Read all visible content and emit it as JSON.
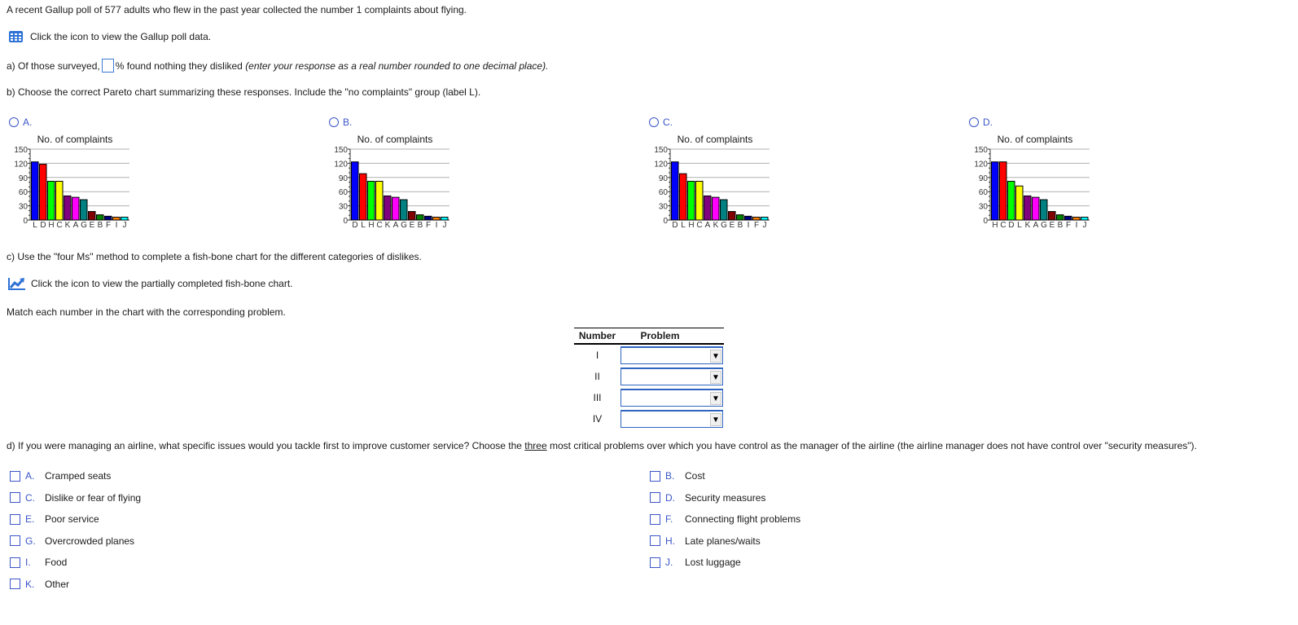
{
  "intro": "A recent Gallup poll of 577 adults who flew in the past year collected the number 1 complaints about flying.",
  "poll_link": {
    "icon": "table-grid-icon",
    "label": "Click the icon to view the Gallup poll data."
  },
  "part_a": {
    "prefix": "a) Of those surveyed,",
    "answer_value": "",
    "suffix": "% found nothing they disliked",
    "hint": "(enter your response as a real number rounded to one decimal place)."
  },
  "part_b": {
    "prompt": "b) Choose the correct Pareto chart summarizing these responses. Include the \"no complaints\" group (label L)."
  },
  "chart_data": [
    {
      "option": "A.",
      "type": "bar",
      "title": "No. of complaints",
      "categories": [
        "L",
        "D",
        "H",
        "C",
        "K",
        "A",
        "G",
        "E",
        "B",
        "F",
        "I",
        "J"
      ],
      "values": [
        123,
        118,
        82,
        82,
        51,
        48,
        43,
        18,
        11,
        8,
        6,
        6
      ],
      "colors": [
        "#0000ff",
        "#ff0000",
        "#00ff00",
        "#ffff00",
        "#800080",
        "#ff00ff",
        "#008080",
        "#800000",
        "#008000",
        "#000080",
        "#ff8000",
        "#00ffff"
      ],
      "yticks": [
        0,
        30,
        60,
        90,
        120,
        150
      ],
      "ylim": [
        0,
        150
      ],
      "grid": true
    },
    {
      "option": "B.",
      "type": "bar",
      "title": "No. of complaints",
      "categories": [
        "D",
        "L",
        "H",
        "C",
        "K",
        "A",
        "G",
        "E",
        "B",
        "F",
        "I",
        "J"
      ],
      "values": [
        123,
        98,
        82,
        82,
        51,
        48,
        43,
        18,
        11,
        8,
        6,
        6
      ],
      "colors": [
        "#0000ff",
        "#ff0000",
        "#00ff00",
        "#ffff00",
        "#800080",
        "#ff00ff",
        "#008080",
        "#800000",
        "#008000",
        "#000080",
        "#ff8000",
        "#00ffff"
      ],
      "yticks": [
        0,
        30,
        60,
        90,
        120,
        150
      ],
      "ylim": [
        0,
        150
      ],
      "grid": true
    },
    {
      "option": "C.",
      "type": "bar",
      "title": "No. of complaints",
      "categories": [
        "D",
        "L",
        "H",
        "C",
        "A",
        "K",
        "G",
        "E",
        "B",
        "I",
        "F",
        "J"
      ],
      "values": [
        123,
        98,
        82,
        82,
        51,
        48,
        43,
        18,
        11,
        8,
        6,
        6
      ],
      "colors": [
        "#0000ff",
        "#ff0000",
        "#00ff00",
        "#ffff00",
        "#800080",
        "#ff00ff",
        "#008080",
        "#800000",
        "#008000",
        "#000080",
        "#ff8000",
        "#00ffff"
      ],
      "yticks": [
        0,
        30,
        60,
        90,
        120,
        150
      ],
      "ylim": [
        0,
        150
      ],
      "grid": true
    },
    {
      "option": "D.",
      "type": "bar",
      "title": "No. of complaints",
      "categories": [
        "H",
        "C",
        "D",
        "L",
        "K",
        "A",
        "G",
        "E",
        "B",
        "F",
        "I",
        "J"
      ],
      "values": [
        123,
        123,
        82,
        72,
        51,
        48,
        43,
        18,
        11,
        8,
        6,
        6
      ],
      "colors": [
        "#0000ff",
        "#ff0000",
        "#00ff00",
        "#ffff00",
        "#800080",
        "#ff00ff",
        "#008080",
        "#800000",
        "#008000",
        "#000080",
        "#ff8000",
        "#00ffff"
      ],
      "yticks": [
        0,
        30,
        60,
        90,
        120,
        150
      ],
      "ylim": [
        0,
        150
      ],
      "grid": true
    }
  ],
  "part_c": {
    "prompt": "c) Use the \"four Ms\" method to complete a fish-bone chart for the different categories of dislikes.",
    "chart_link": {
      "icon": "trend-chart-icon",
      "label": "Click the icon to view the partially completed fish-bone chart."
    },
    "instruction": "Match each number in the chart with the corresponding problem.",
    "table": {
      "headers": [
        "Number",
        "Problem"
      ],
      "rows": [
        {
          "number": "I",
          "selected": ""
        },
        {
          "number": "II",
          "selected": ""
        },
        {
          "number": "III",
          "selected": ""
        },
        {
          "number": "IV",
          "selected": ""
        }
      ]
    }
  },
  "part_d": {
    "prompt_before": "d) If you were managing an airline, what specific issues would you tackle first to improve customer service? Choose the ",
    "prompt_emph": "three",
    "prompt_after": " most critical problems over which you have control as the manager of the airline (the airline manager does not have control over \"security measures\").",
    "options": [
      {
        "letter": "A.",
        "label": "Cramped seats",
        "checked": false
      },
      {
        "letter": "B.",
        "label": "Cost",
        "checked": false
      },
      {
        "letter": "C.",
        "label": "Dislike or fear of flying",
        "checked": false
      },
      {
        "letter": "D.",
        "label": "Security measures",
        "checked": false
      },
      {
        "letter": "E.",
        "label": "Poor service",
        "checked": false
      },
      {
        "letter": "F.",
        "label": "Connecting flight problems",
        "checked": false
      },
      {
        "letter": "G.",
        "label": "Overcrowded planes",
        "checked": false
      },
      {
        "letter": "H.",
        "label": "Late planes/waits",
        "checked": false
      },
      {
        "letter": "I.",
        "label": "Food",
        "checked": false
      },
      {
        "letter": "J.",
        "label": "Lost luggage",
        "checked": false
      },
      {
        "letter": "K.",
        "label": "Other",
        "checked": false
      }
    ]
  }
}
